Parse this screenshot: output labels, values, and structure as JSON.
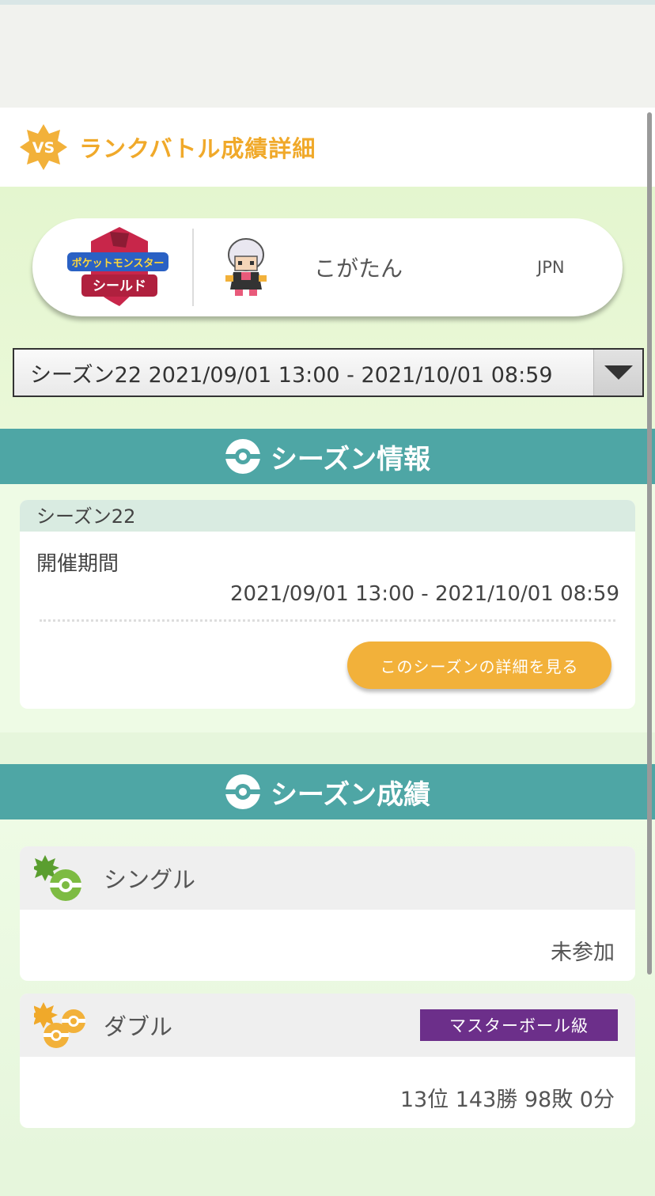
{
  "header": {
    "title": "ランクバトル成績詳細",
    "badge_text": "VS"
  },
  "profile": {
    "game_logo_top": "ポケットモンスター",
    "game_logo_bottom": "シールド",
    "trainer_name": "こがたん",
    "region": "JPN"
  },
  "season_select": {
    "selected": "シーズン22 2021/09/01 13:00 - 2021/10/01 08:59"
  },
  "season_info": {
    "section_title": "シーズン情報",
    "season_name": "シーズン22",
    "period_label": "開催期間",
    "period_value": "2021/09/01 13:00 - 2021/10/01 08:59",
    "detail_button": "このシーズンの詳細を見る"
  },
  "season_results": {
    "section_title": "シーズン成績",
    "single": {
      "label": "シングル",
      "value": "未参加"
    },
    "double": {
      "label": "ダブル",
      "rank": "マスターボール級",
      "value": "13位 143勝 98敗 0分"
    }
  },
  "colors": {
    "title_orange": "#f0a92a",
    "section_teal": "#4ea6a5",
    "button_orange": "#f2b13a",
    "master_purple": "#6c2f8a"
  }
}
